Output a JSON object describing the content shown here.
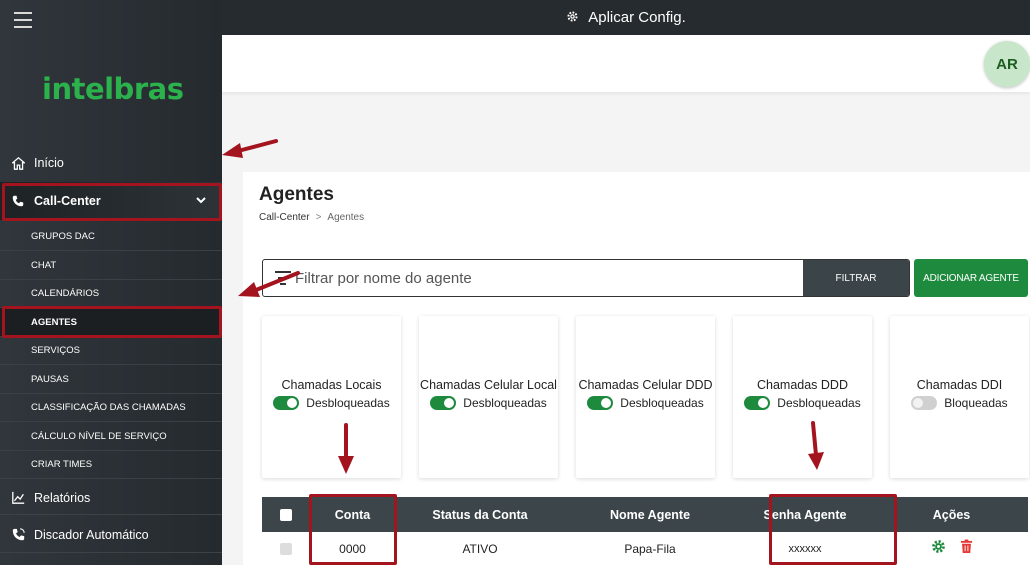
{
  "topbar": {
    "apply_label": "Aplicar Config."
  },
  "header": {
    "avatar_initials": "AR"
  },
  "brand": {
    "logo_text": "intelbras",
    "accent": "#2bb24c"
  },
  "sidebar": {
    "inicio": "Início",
    "call_center": "Call-Center",
    "sub_items": [
      "GRUPOS DAC",
      "CHAT",
      "CALENDÁRIOS",
      "AGENTES",
      "SERVIÇOS",
      "PAUSAS",
      "CLASSIFICAÇÃO DAS CHAMADAS",
      "CÁLCULO NÍVEL DE SERVIÇO",
      "CRIAR TIMES"
    ],
    "relatorios": "Relatórios",
    "discador": "Discador Automático"
  },
  "page": {
    "title": "Agentes",
    "breadcrumb_parent": "Call-Center",
    "breadcrumb_sep": ">",
    "breadcrumb_current": "Agentes"
  },
  "search": {
    "placeholder": "Filtrar por nome do agente",
    "filter_label": "FILTRAR",
    "add_label": "ADICIONAR AGENTE"
  },
  "permissions": [
    {
      "title": "Chamadas Locais",
      "status": "Desbloqueadas",
      "enabled": true
    },
    {
      "title": "Chamadas Celular Local",
      "status": "Desbloqueadas",
      "enabled": true
    },
    {
      "title": "Chamadas Celular DDD",
      "status": "Desbloqueadas",
      "enabled": true
    },
    {
      "title": "Chamadas DDD",
      "status": "Desbloqueadas",
      "enabled": true
    },
    {
      "title": "Chamadas DDI",
      "status": "Bloqueadas",
      "enabled": false
    }
  ],
  "table": {
    "headers": [
      "Conta",
      "Status da Conta",
      "Nome Agente",
      "Senha Agente",
      "Ações"
    ],
    "rows": [
      {
        "conta": "0000",
        "status": "ATIVO",
        "nome": "Papa-Fila",
        "senha": "xxxxxx"
      }
    ]
  },
  "colors": {
    "success": "#1e8a3e",
    "danger": "#e53935",
    "annotation": "#a3141f"
  }
}
